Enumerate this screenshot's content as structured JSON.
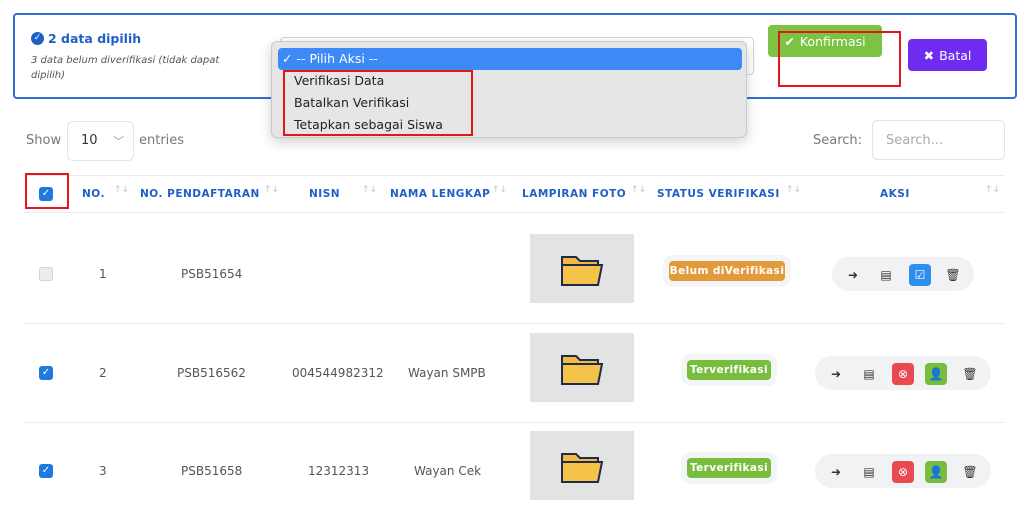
{
  "bulk_panel": {
    "selected_count_text": "2 data dipilih",
    "unverified_note": "3 data belum diverifikasi (tidak dapat dipilih)",
    "confirm_label": "Konfirmasi",
    "cancel_label": "Batal"
  },
  "action_dropdown": {
    "selected": "-- Pilih Aksi --",
    "options": [
      "Verifikasi Data",
      "Batalkan Verifikasi",
      "Tetapkan sebagai Siswa"
    ]
  },
  "table_controls": {
    "show_label": "Show",
    "entries_value": "10",
    "entries_label": "entries",
    "search_label": "Search:",
    "search_placeholder": "Search..."
  },
  "table": {
    "headers": [
      "NO.",
      "NO. PENDAFTARAN",
      "NISN",
      "NAMA LENGKAP",
      "LAMPIRAN FOTO",
      "STATUS VERIFIKASI",
      "AKSI"
    ],
    "rows": [
      {
        "checked": false,
        "no": "1",
        "reg_no": "PSB51654",
        "nisn": "",
        "name": "",
        "status": "Belum diVerifikasi"
      },
      {
        "checked": true,
        "no": "2",
        "reg_no": "PSB516562",
        "nisn": "004544982312",
        "name": "Wayan SMPB",
        "status": "Terverifikasi"
      },
      {
        "checked": true,
        "no": "3",
        "reg_no": "PSB51658",
        "nisn": "12312313",
        "name": "Wayan Cek",
        "status": "Terverifikasi"
      }
    ]
  },
  "colors": {
    "primary_blue": "#1e5fc8",
    "confirm_green": "#7cc243",
    "cancel_purple": "#6f2cf0",
    "highlight_red": "#e3161b",
    "status_warning": "#e39a3b",
    "status_success": "#79bd3e"
  }
}
